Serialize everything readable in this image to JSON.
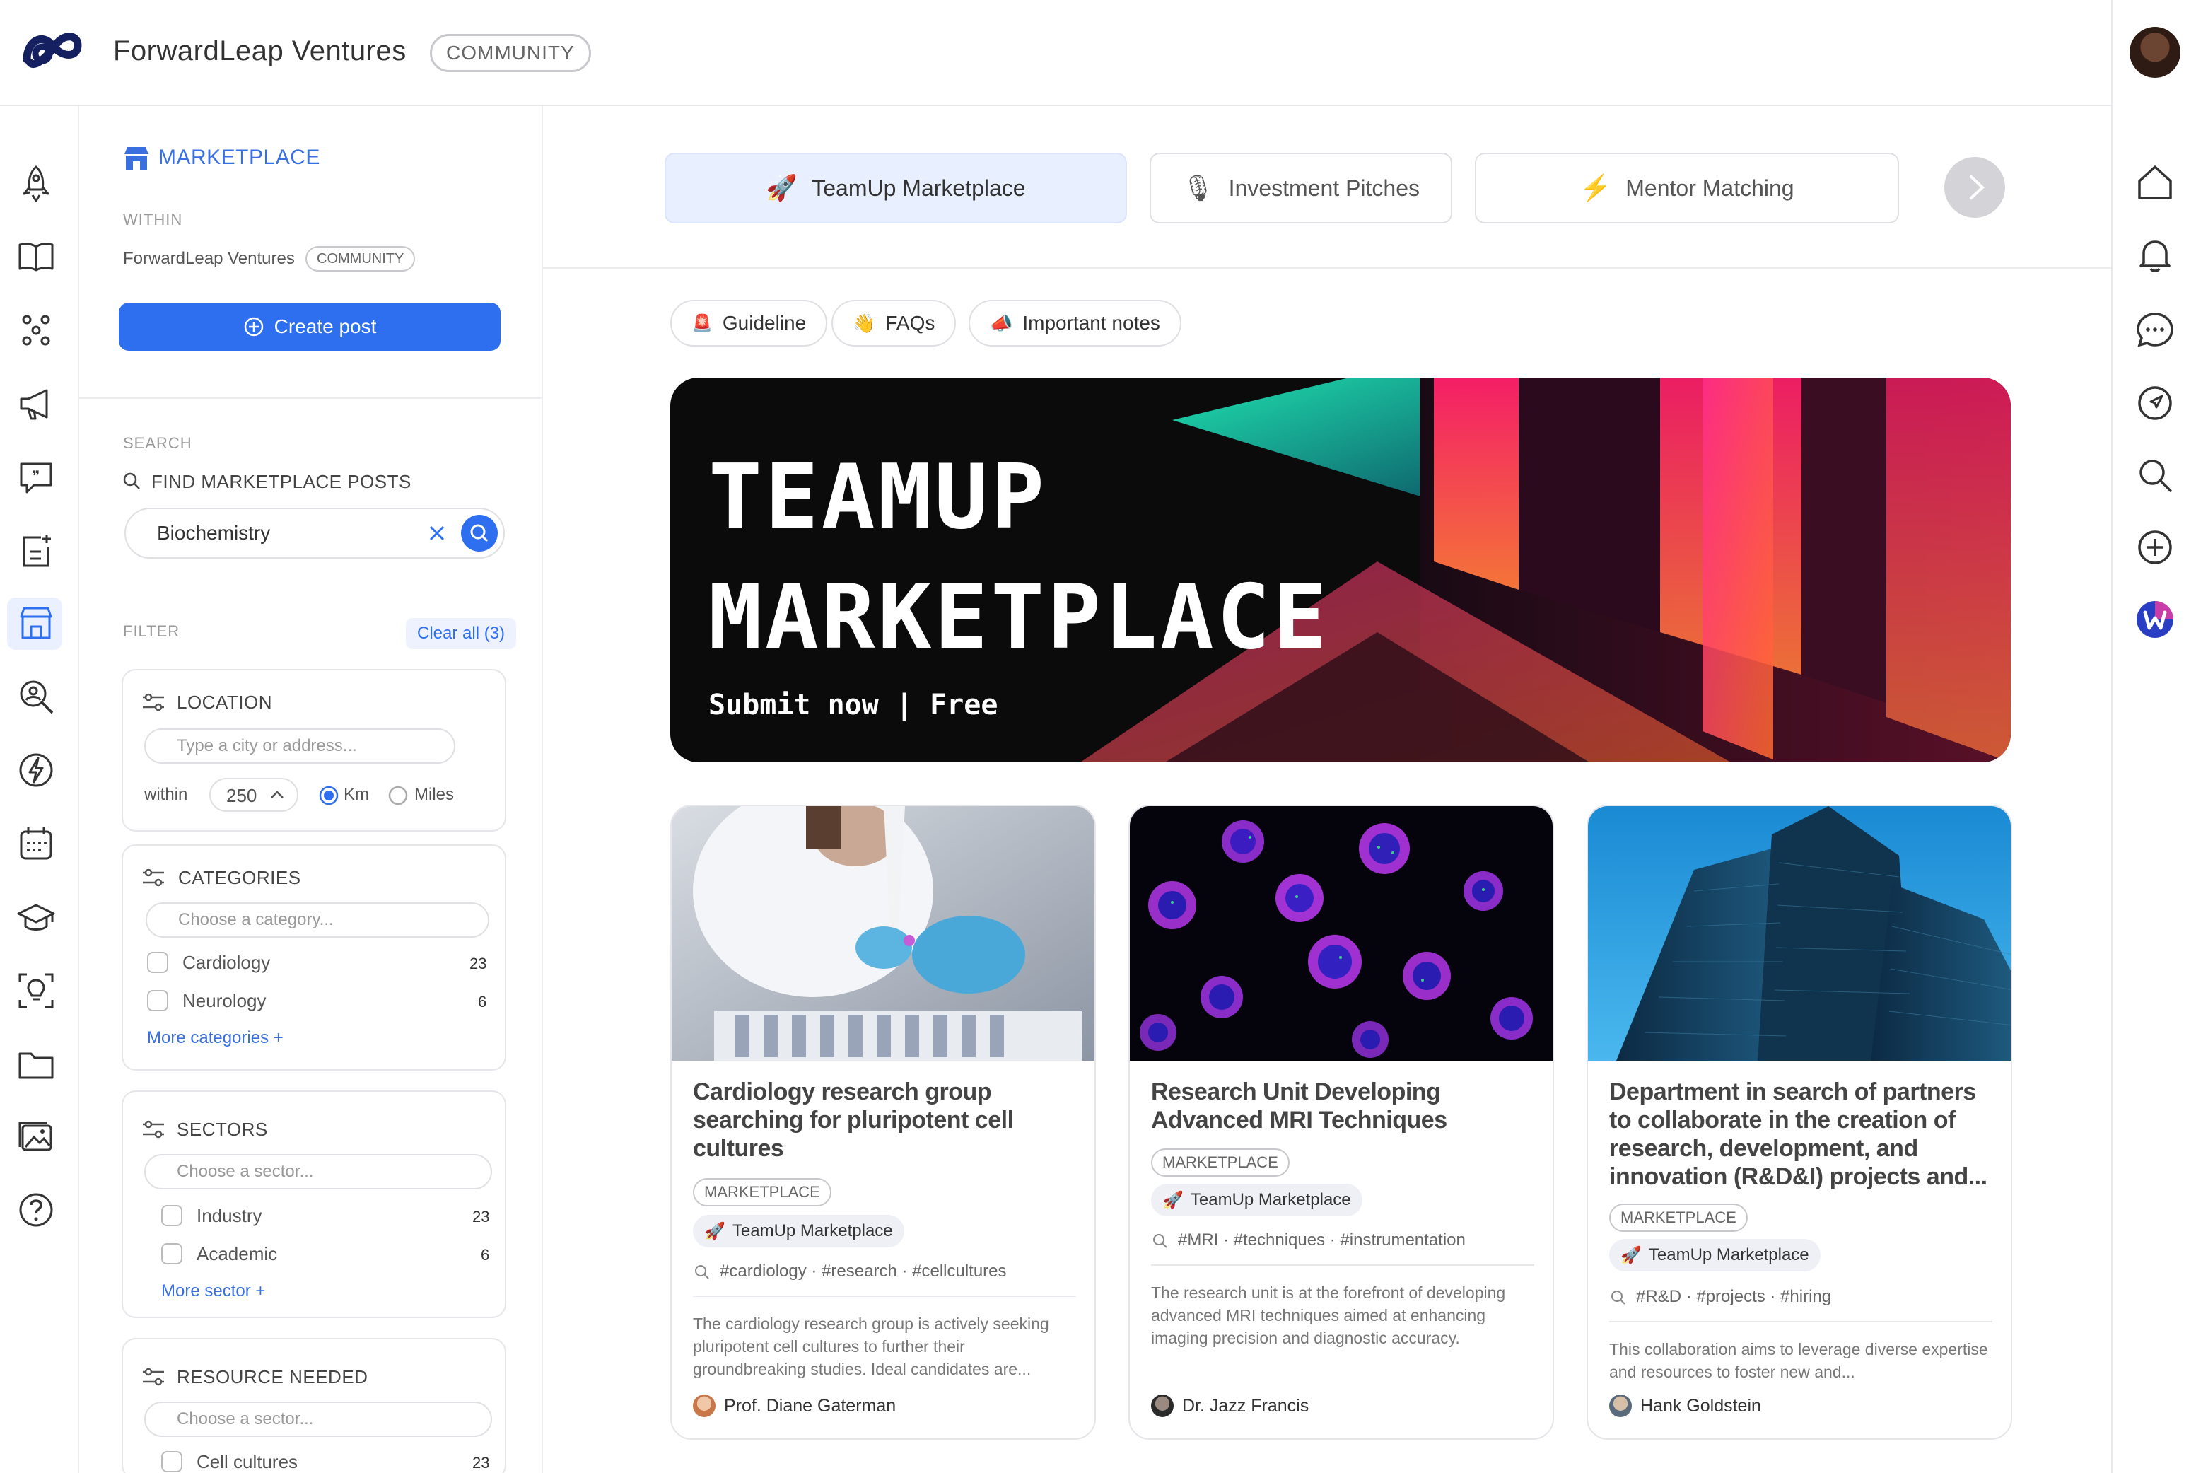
{
  "header": {
    "brand": "ForwardLeap Ventures",
    "community_badge": "COMMUNITY"
  },
  "sidebar": {
    "section_title": "MARKETPLACE",
    "within_label": "WITHIN",
    "within_name": "ForwardLeap Ventures",
    "within_badge": "COMMUNITY",
    "create_label": "Create post",
    "search_label": "SEARCH",
    "find_label": "FIND MARKETPLACE POSTS",
    "search_value": "Biochemistry",
    "filter_label": "FILTER",
    "clear_all": "Clear all (3)",
    "location": {
      "title": "LOCATION",
      "placeholder": "Type a city or address...",
      "within": "within",
      "distance": "250",
      "unit_km": "Km",
      "unit_miles": "Miles"
    },
    "categories": {
      "title": "CATEGORIES",
      "placeholder": "Choose a category...",
      "items": [
        {
          "label": "Cardiology",
          "count": "23"
        },
        {
          "label": "Neurology",
          "count": "6"
        }
      ],
      "more": "More categories +"
    },
    "sectors": {
      "title": "SECTORS",
      "placeholder": "Choose a sector...",
      "items": [
        {
          "label": "Industry",
          "count": "23"
        },
        {
          "label": "Academic",
          "count": "6"
        }
      ],
      "more": "More sector +"
    },
    "resource": {
      "title": "RESOURCE NEEDED",
      "placeholder": "Choose a sector...",
      "items": [
        {
          "label": "Cell cultures",
          "count": "23"
        }
      ]
    }
  },
  "tabs": [
    {
      "label": "TeamUp Marketplace",
      "icon": "rocket-icon",
      "active": true
    },
    {
      "label": "Investment Pitches",
      "icon": "microphone-icon",
      "active": false
    },
    {
      "label": "Mentor Matching",
      "icon": "lightning-icon",
      "active": false
    }
  ],
  "chips": [
    {
      "label": "Guideline",
      "icon": "siren-icon"
    },
    {
      "label": "FAQs",
      "icon": "waving-hand-icon"
    },
    {
      "label": "Important notes",
      "icon": "megaphone-icon"
    }
  ],
  "banner": {
    "line1": "TEAMUP",
    "line2": "MARKETPLACE",
    "subtitle": "Submit now | Free"
  },
  "posts": [
    {
      "title": "Cardiology research group searching for pluripotent cell cultures",
      "tag": "MARKETPLACE",
      "marketplace": "TeamUp Marketplace",
      "hashtags": "#cardiology · #research · #cellcultures",
      "description": "The cardiology research group is actively seeking pluripotent cell cultures to further their groundbreaking studies. Ideal candidates are...",
      "author": "Prof. Diane Gaterman"
    },
    {
      "title": "Research Unit Developing Advanced MRI Techniques",
      "tag": "MARKETPLACE",
      "marketplace": "TeamUp Marketplace",
      "hashtags": "#MRI · #techniques · #instrumentation",
      "description": "The research unit is at the forefront of developing advanced MRI techniques aimed at enhancing imaging precision and diagnostic accuracy.",
      "author": "Dr. Jazz Francis"
    },
    {
      "title": "Department in search of partners to collaborate in the creation of research, development, and innovation (R&D&I) projects and...",
      "tag": "MARKETPLACE",
      "marketplace": "TeamUp Marketplace",
      "hashtags": "#R&D · #projects · #hiring",
      "description": "This collaboration aims to leverage diverse expertise and resources to foster new and...",
      "author": "Hank Goldstein"
    }
  ],
  "colors": {
    "accent": "#2e6ff0",
    "accent_text": "#3a6fe0",
    "active_tab_bg": "#e8efff"
  }
}
